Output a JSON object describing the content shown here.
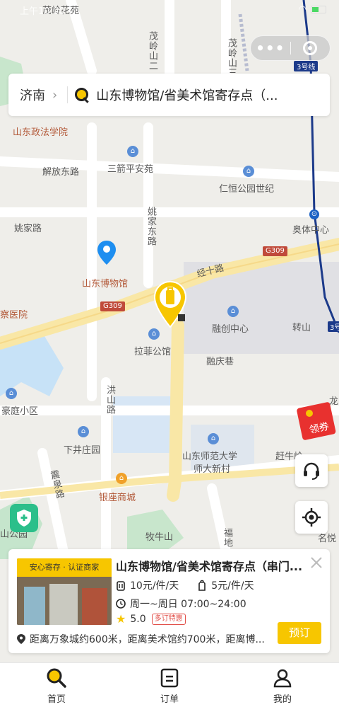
{
  "status": {
    "time": "上午10:00"
  },
  "search": {
    "city": "济南",
    "query": "山东博物馆/省美术馆寄存点（..."
  },
  "map": {
    "labels": {
      "maolinghuayuan": "茂岭花苑",
      "maolingshan1": "茂岭山二",
      "maolingshan2": "茂岭山三",
      "metro3_top": "3号线",
      "zhengfa": "山东政法学院",
      "jiefang_east": "解放东路",
      "sanjianping": "三箭平安苑",
      "renheng": "仁恒公园世纪",
      "yaojia_road": "姚家路",
      "yaojia_east": "姚家东路",
      "olympic": "奥体中心",
      "museum": "山东博物馆",
      "g309_right": "G309",
      "jingshi": "经十路",
      "g309_left": "G309",
      "hospital": "察医院",
      "ronchuang": "融创中心",
      "zhuanshan": "转山",
      "metro3_right": "3号",
      "lafei": "拉菲公馆",
      "rongqing": "融庆巷",
      "haoting": "豪庭小区",
      "hongshan": "洪山路",
      "xiajing": "下井庄园",
      "normal": "山东师范大学",
      "normal2": "师大新村",
      "ganniu": "赶牛岭",
      "zhenyuan": "震泉路",
      "yinzuo": "银座商城",
      "muniu": "牧牛山",
      "mingyue": "名悦",
      "shangongyuan": "山公园",
      "fudi": "福地",
      "long": "龙"
    }
  },
  "coupon": {
    "label": "领券"
  },
  "card": {
    "tag": "安心寄存 · 认证商家",
    "title": "山东博物馆/省美术馆寄存点（串门...",
    "price_large": "10元/件/天",
    "price_small": "5元/件/天",
    "hours": "周一~周日 07:00~24:00",
    "rating": "5.0",
    "badge": "多订特惠",
    "book": "预订",
    "distance": "距离万象城约600米，距离美术馆约700米，距离博..."
  },
  "tabs": [
    {
      "label": "首页"
    },
    {
      "label": "订单"
    },
    {
      "label": "我的"
    }
  ]
}
